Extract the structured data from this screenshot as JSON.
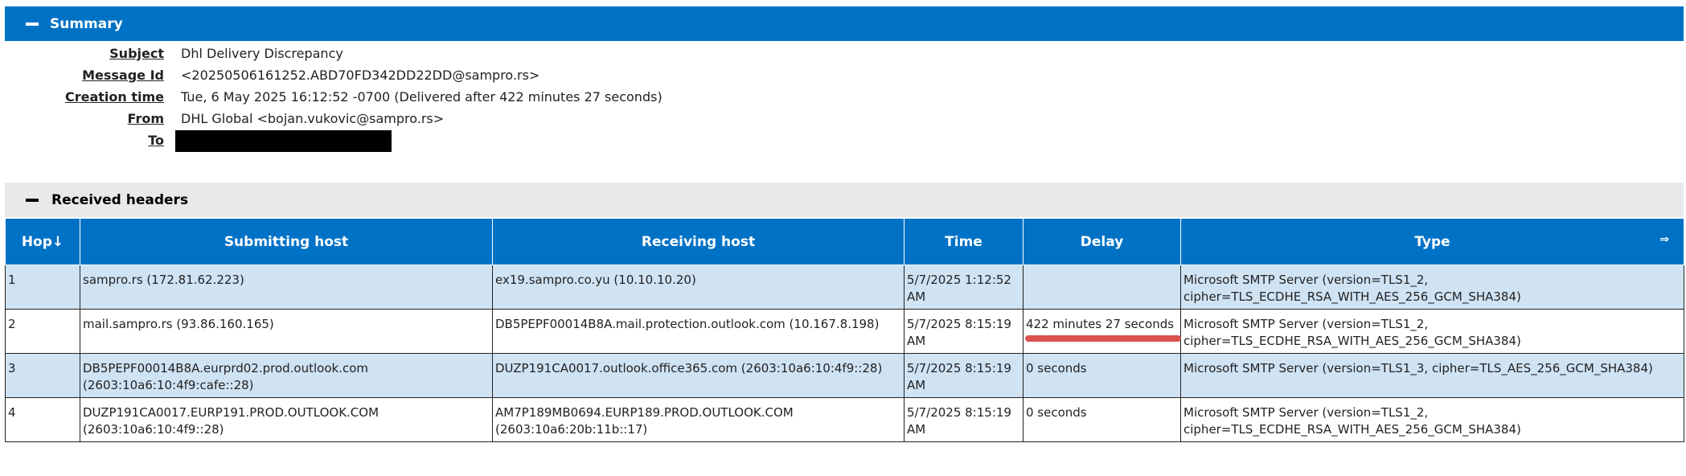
{
  "summary": {
    "title": "Summary",
    "fields": [
      {
        "label": "Subject",
        "value": "Dhl Delivery Discrepancy"
      },
      {
        "label": "Message Id",
        "value": "<20250506161252.ABD70FD342DD22DD@sampro.rs>"
      },
      {
        "label": "Creation time",
        "value": "Tue, 6 May 2025 16:12:52 -0700 (Delivered after 422 minutes 27 seconds)"
      },
      {
        "label": "From",
        "value": "DHL Global <bojan.vukovic@sampro.rs>"
      },
      {
        "label": "To",
        "value": ""
      }
    ]
  },
  "received_headers": {
    "title": "Received headers",
    "columns": {
      "hop": "Hop↓",
      "submitting": "Submitting host",
      "receiving": "Receiving host",
      "time": "Time",
      "delay": "Delay",
      "type": "Type",
      "expand": "⇒"
    },
    "rows": [
      {
        "hop": "1",
        "submitting": "sampro.rs (172.81.62.223)",
        "receiving": "ex19.sampro.co.yu (10.10.10.20)",
        "time": "5/7/2025 1:12:52 AM",
        "delay": "",
        "type": "Microsoft SMTP Server (version=TLS1_2, cipher=TLS_ECDHE_RSA_WITH_AES_256_GCM_SHA384)"
      },
      {
        "hop": "2",
        "submitting": "mail.sampro.rs (93.86.160.165)",
        "receiving": "DB5PEPF00014B8A.mail.protection.outlook.com (10.167.8.198)",
        "time": "5/7/2025 8:15:19 AM",
        "delay": "422 minutes 27 seconds",
        "type": "Microsoft SMTP Server (version=TLS1_2, cipher=TLS_ECDHE_RSA_WITH_AES_256_GCM_SHA384)"
      },
      {
        "hop": "3",
        "submitting": "DB5PEPF00014B8A.eurprd02.prod.outlook.com (2603:10a6:10:4f9:cafe::28)",
        "receiving": "DUZP191CA0017.outlook.office365.com (2603:10a6:10:4f9::28)",
        "time": "5/7/2025 8:15:19 AM",
        "delay": "0 seconds",
        "type": "Microsoft SMTP Server (version=TLS1_3, cipher=TLS_AES_256_GCM_SHA384)"
      },
      {
        "hop": "4",
        "submitting": "DUZP191CA0017.EURP191.PROD.OUTLOOK.COM (2603:10a6:10:4f9::28)",
        "receiving": "AM7P189MB0694.EURP189.PROD.OUTLOOK.COM (2603:10a6:20b:11b::17)",
        "time": "5/7/2025 8:15:19 AM",
        "delay": "0 seconds",
        "type": "Microsoft SMTP Server (version=TLS1_2, cipher=TLS_ECDHE_RSA_WITH_AES_256_GCM_SHA384)"
      }
    ]
  },
  "colors": {
    "header_blue": "#0072c6",
    "row_highlight": "#cfe3f3",
    "section_gray": "#e8e9eb",
    "annotation_red": "#d9534f"
  }
}
